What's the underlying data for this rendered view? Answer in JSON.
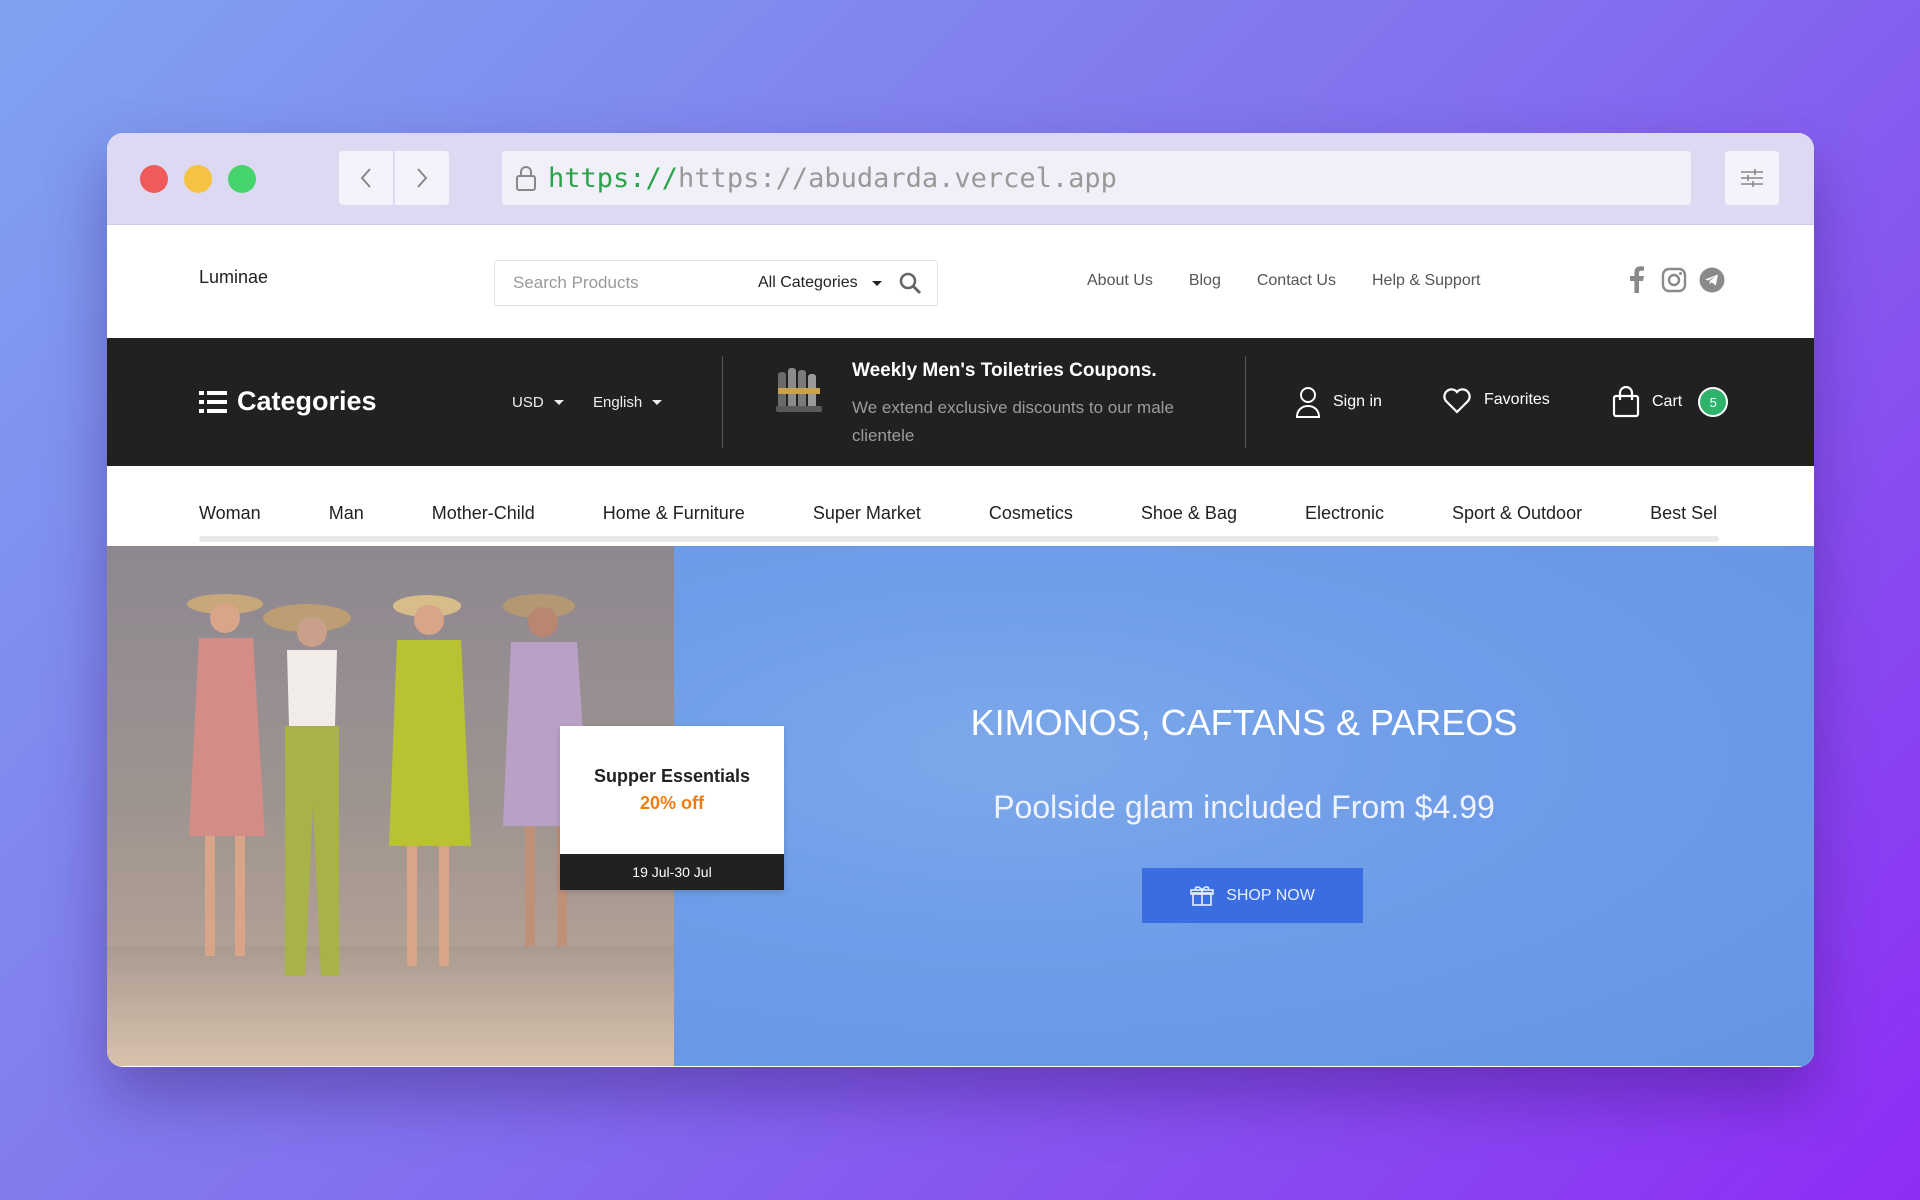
{
  "browser": {
    "url_scheme": "https://",
    "url_host": "https://abudarda.vercel.app"
  },
  "header": {
    "logo": "Luminae",
    "search_placeholder": "Search Products",
    "category_select": "All Categories",
    "links": [
      "About Us",
      "Blog",
      "Contact Us",
      "Help & Support"
    ],
    "social_icons": [
      "facebook-icon",
      "instagram-icon",
      "telegram-icon"
    ]
  },
  "darkbar": {
    "categories_label": "Categories",
    "currency": "USD",
    "language": "English",
    "promo_title": "Weekly Men's Toiletries Coupons.",
    "promo_text": "We extend exclusive discounts to our male clientele",
    "signin_label": "Sign in",
    "favorites_label": "Favorites",
    "cart_label": "Cart",
    "cart_count": "5"
  },
  "nav": {
    "items": [
      "Woman",
      "Man",
      "Mother-Child",
      "Home & Furniture",
      "Super Market",
      "Cosmetics",
      "Shoe & Bag",
      "Electronic",
      "Sport & Outdoor",
      "Best Sel"
    ]
  },
  "hero": {
    "card_title": "Supper Essentials",
    "card_discount": "20% off",
    "card_date": "19 Jul-30 Jul",
    "title": "KIMONOS, CAFTANS & PAREOS",
    "subtitle": "Poolside glam included From $4.99",
    "cta": "SHOP NOW"
  },
  "colors": {
    "accent_green": "#2fb36b",
    "discount_orange": "#f07d12",
    "cta_blue": "#3a6ee0",
    "banner_blue": "#6f9de8",
    "dark_bar": "#212121"
  }
}
